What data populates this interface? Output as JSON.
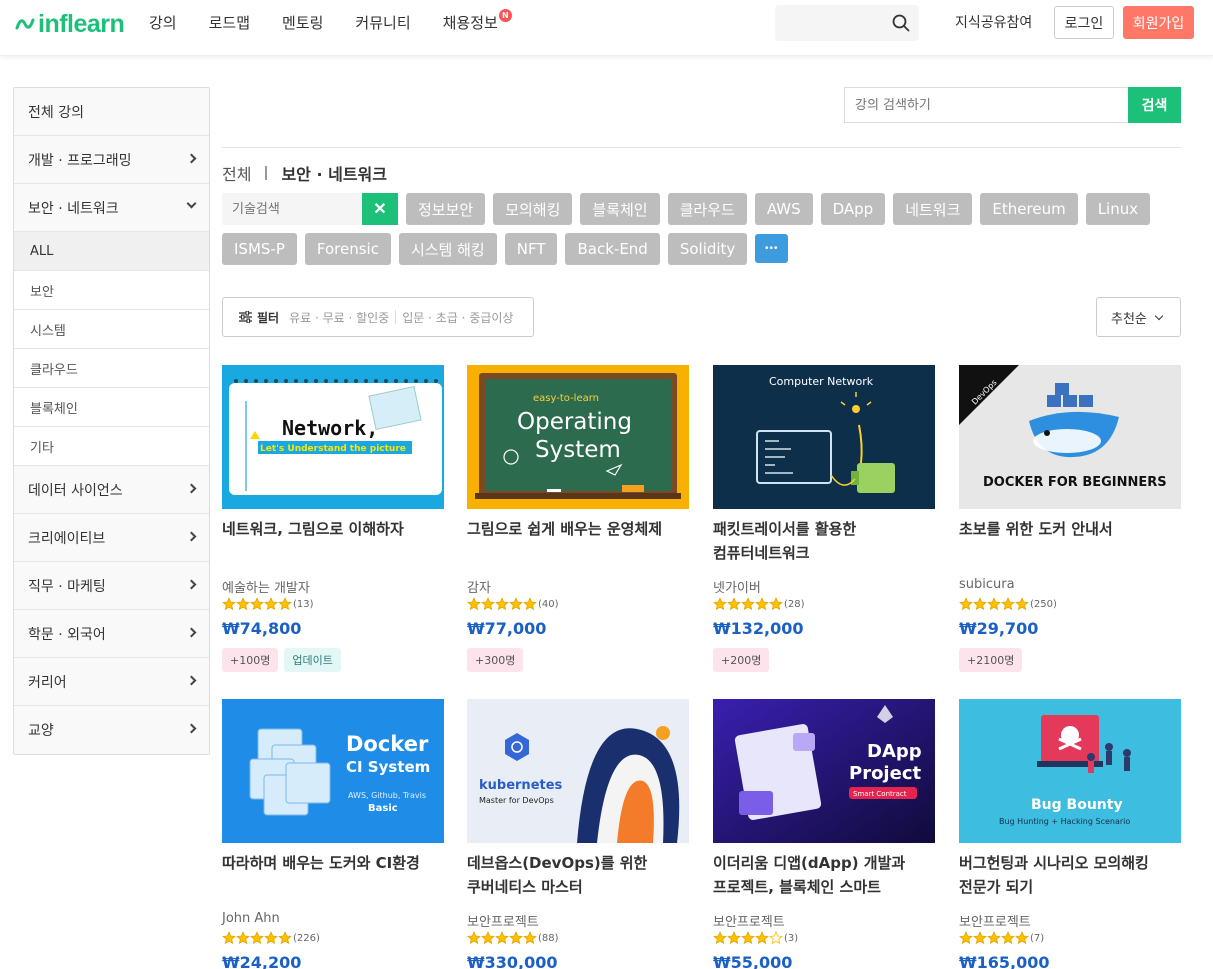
{
  "header": {
    "logo_text": "inflearn",
    "nav": [
      {
        "label": "강의"
      },
      {
        "label": "로드맵"
      },
      {
        "label": "멘토링"
      },
      {
        "label": "커뮤니티"
      },
      {
        "label": "채용정보",
        "badge": "N"
      }
    ],
    "search_placeholder": "",
    "knowledge_share": "지식공유참여",
    "login": "로그인",
    "signup": "회원가입"
  },
  "sidebar": {
    "items": [
      {
        "label": "전체 강의"
      },
      {
        "label": "개발 · 프로그래밍"
      },
      {
        "label": "보안 · 네트워크"
      },
      {
        "label": "데이터 사이언스"
      },
      {
        "label": "크리에이티브"
      },
      {
        "label": "직무 · 마케팅"
      },
      {
        "label": "학문 · 외국어"
      },
      {
        "label": "커리어"
      },
      {
        "label": "교양"
      }
    ],
    "subitems": [
      {
        "label": "ALL"
      },
      {
        "label": "보안"
      },
      {
        "label": "시스템"
      },
      {
        "label": "클라우드"
      },
      {
        "label": "블록체인"
      },
      {
        "label": "기타"
      }
    ]
  },
  "main": {
    "search_placeholder": "강의 검색하기",
    "search_button": "검색",
    "breadcrumb_all": "전체",
    "breadcrumb_current": "보안 · 네트워크",
    "tech_search_placeholder": "기술검색",
    "tech_clear": "✕",
    "tags_row1": [
      "정보보안",
      "모의해킹",
      "블록체인",
      "클라우드",
      "AWS",
      "DApp",
      "네트워크",
      "Ethereum",
      "Linux"
    ],
    "tags_row2": [
      "ISMS-P",
      "Forensic",
      "시스템 해킹",
      "NFT",
      "Back-End",
      "Solidity"
    ],
    "tag_more": "•••",
    "filter_label": "필터",
    "filter_price": "유료 · 무료 · 할인중",
    "filter_level": "입문 · 초급 · 중급이상",
    "sort_label": "추천순"
  },
  "thumb_text": {
    "network_title": "Network,",
    "network_sub": "Let's Understand the picture",
    "os_small": "easy-to-learn",
    "os_line1": "Operating",
    "os_line2": "System",
    "cn_title": "Computer Network",
    "devops_ribbon": "DevOps",
    "docker_beg": "DOCKER FOR BEGINNERS",
    "ci_line1": "Docker",
    "ci_line2": "CI System",
    "ci_line3": "AWS, Github, Travis",
    "ci_line4": "Basic",
    "k8s_name": "kubernetes",
    "k8s_sub": "Master for DevOps",
    "dapp_line1": "DApp",
    "dapp_line2": "Project",
    "dapp_tag": "Smart Contract",
    "bug_line1": "Bug Bounty",
    "bug_line2": "Bug Hunting + Hacking Scenario"
  },
  "courses": [
    {
      "title": "네트워크, 그림으로 이해하자",
      "author": "예술하는 개발자",
      "rating": 5,
      "count": "(13)",
      "price": "₩74,800",
      "badges": [
        {
          "text": "+100명",
          "type": "pink"
        },
        {
          "text": "업데이트",
          "type": "mint"
        }
      ]
    },
    {
      "title": "그림으로 쉽게 배우는 운영체제",
      "author": "감자",
      "rating": 5,
      "count": "(40)",
      "price": "₩77,000",
      "badges": [
        {
          "text": "+300명",
          "type": "pink"
        }
      ]
    },
    {
      "title": "패킷트레이서를 활용한 컴퓨터네트워크",
      "author": "넷가이버",
      "rating": 5,
      "count": "(28)",
      "price": "₩132,000",
      "badges": [
        {
          "text": "+200명",
          "type": "pink"
        }
      ]
    },
    {
      "title": "초보를 위한 도커 안내서",
      "author": "subicura",
      "rating": 5,
      "count": "(250)",
      "price": "₩29,700",
      "badges": [
        {
          "text": "+2100명",
          "type": "pink"
        }
      ]
    },
    {
      "title": "따라하며 배우는 도커와 CI환경",
      "author": "John Ahn",
      "rating": 5,
      "count": "(226)",
      "price": "₩24,200",
      "badges": []
    },
    {
      "title": "데브옵스(DevOps)를 위한 쿠버네티스 마스터",
      "author": "보안프로젝트",
      "rating": 5,
      "count": "(88)",
      "price": "₩330,000",
      "badges": []
    },
    {
      "title": "이더리움 디앱(dApp) 개발과 프로젝트, 블록체인 스마트 컨트랙트",
      "author": "보안프로젝트",
      "rating": 4,
      "count": "(3)",
      "price": "₩55,000",
      "badges": []
    },
    {
      "title": "버그헌팅과 시나리오 모의해킹 전문가 되기",
      "author": "보안프로젝트",
      "rating": 5,
      "count": "(7)",
      "price": "₩165,000",
      "badges": []
    }
  ],
  "colors": {
    "brand": "#1dc078",
    "price": "#1a60c5",
    "signup": "#ff7867",
    "star": "#ffc000"
  }
}
